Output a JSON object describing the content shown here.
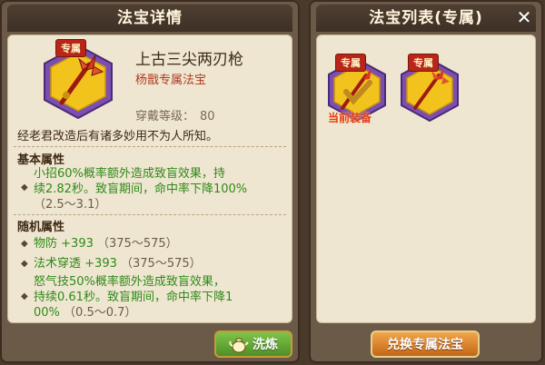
{
  "left_panel": {
    "title": "法宝详情",
    "item": {
      "tag": "专属",
      "name": "上古三尖两刃枪",
      "subtitle": "杨戬专属法宝",
      "level_label": "穿戴等级：",
      "level_value": "80",
      "description": "经老君改造后有诸多妙用不为人所知。"
    },
    "basic_section_label": "基本属性",
    "basic_lines": [
      "小招60%概率额外造成致盲效果，持",
      "续2.82秒。致盲期间，命中率下降100%"
    ],
    "basic_range": "（2.5～3.1）",
    "random_section_label": "随机属性",
    "random_attrs": [
      {
        "name": "物防",
        "value": "+393",
        "range": "（375～575）"
      },
      {
        "name": "法术穿透",
        "value": "+393",
        "range": "（375～575）"
      }
    ],
    "random_effect_lines": [
      "怒气技50%概率额外造成致盲效果，",
      "持续0.61秒。致盲期间，命中率下降1",
      "00%"
    ],
    "random_effect_range": "（0.5～0.7）",
    "refine_button_label": "洗炼"
  },
  "right_panel": {
    "title": "法宝列表(专属)",
    "items": [
      {
        "tag": "专属",
        "equipped_label": "当前装备"
      },
      {
        "tag": "专属"
      }
    ],
    "swap_button_label": "兑换专属法宝"
  },
  "colors": {
    "badge_outer": "#7a4fb0",
    "badge_inner": "#f2c21d",
    "accent_red": "#b8261a",
    "attr_green": "#2e8a16"
  }
}
